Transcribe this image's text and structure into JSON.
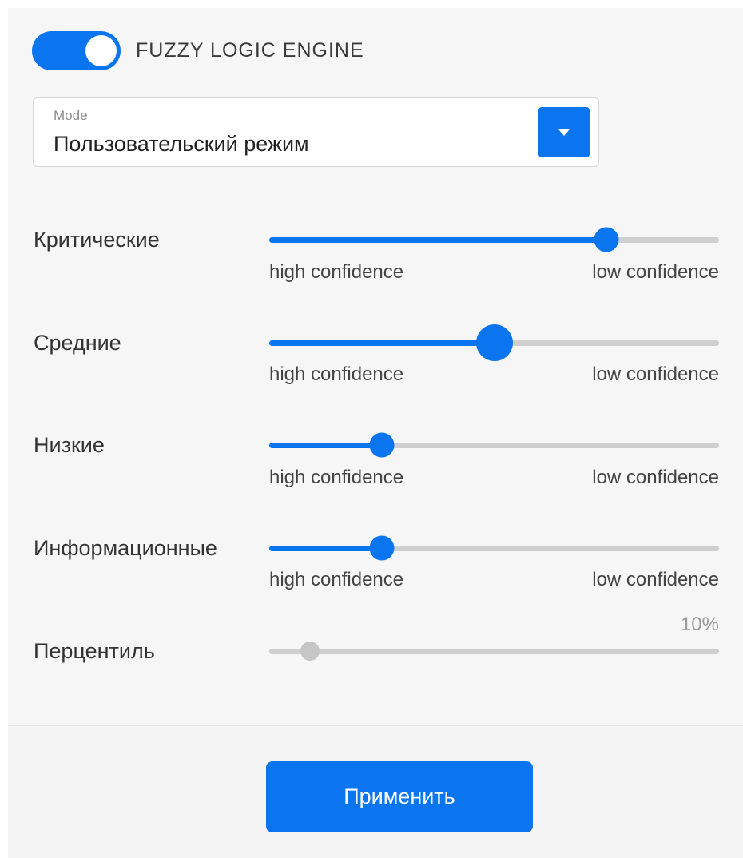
{
  "engine": {
    "label": "FUZZY LOGIC ENGINE",
    "enabled": true
  },
  "mode": {
    "caption": "Mode",
    "value": "Пользовательский режим",
    "dropdown_icon": "caret-down-icon"
  },
  "sliders": [
    {
      "label": "Критические",
      "value_fraction": 0.75,
      "min_label": "high confidence",
      "max_label": "low confidence"
    },
    {
      "label": "Средние",
      "value_fraction": 0.5,
      "min_label": "high confidence",
      "max_label": "low confidence"
    },
    {
      "label": "Низкие",
      "value_fraction": 0.25,
      "min_label": "high confidence",
      "max_label": "low confidence"
    },
    {
      "label": "Информационные",
      "value_fraction": 0.25,
      "min_label": "high confidence",
      "max_label": "low confidence"
    }
  ],
  "percentile": {
    "label": "Перцентиль",
    "value_text": "10%",
    "value_fraction": 0.09,
    "disabled": true
  },
  "apply": {
    "label": "Применить"
  },
  "colors": {
    "accent": "#0a75ee",
    "track": "#cfcfcf",
    "panel": "#f6f6f6"
  }
}
